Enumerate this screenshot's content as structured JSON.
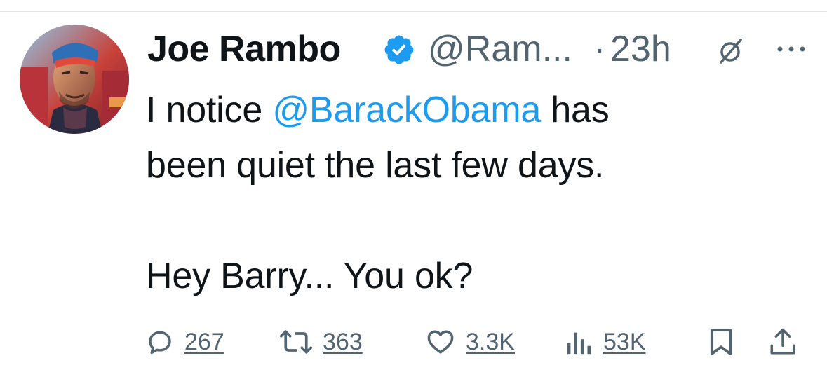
{
  "author": {
    "name": "Joe Rambo",
    "handle": "@Ram...",
    "separator": "·",
    "time": "23h",
    "verified": true,
    "avatar_icon": "avatar-illustration"
  },
  "tweet": {
    "text_before_mention": "I notice ",
    "mention": "@BarackObama",
    "text_after_mention": " has",
    "line2": "been quiet the last few days.",
    "line3": "Hey Barry... You ok?"
  },
  "actions": {
    "replies": "267",
    "retweets": "363",
    "likes": "3.3K",
    "views": "53K"
  },
  "colors": {
    "accent": "#1d9bf0",
    "text": "#0f1419",
    "secondary": "#536471",
    "verified_badge": "#1d9bf0"
  },
  "icons": {
    "verified": "verified-badge-icon",
    "grok": "grok-icon",
    "more": "more-icon",
    "reply": "reply-icon",
    "retweet": "retweet-icon",
    "like": "heart-icon",
    "views": "views-chart-icon",
    "bookmark": "bookmark-icon",
    "share": "share-icon"
  }
}
